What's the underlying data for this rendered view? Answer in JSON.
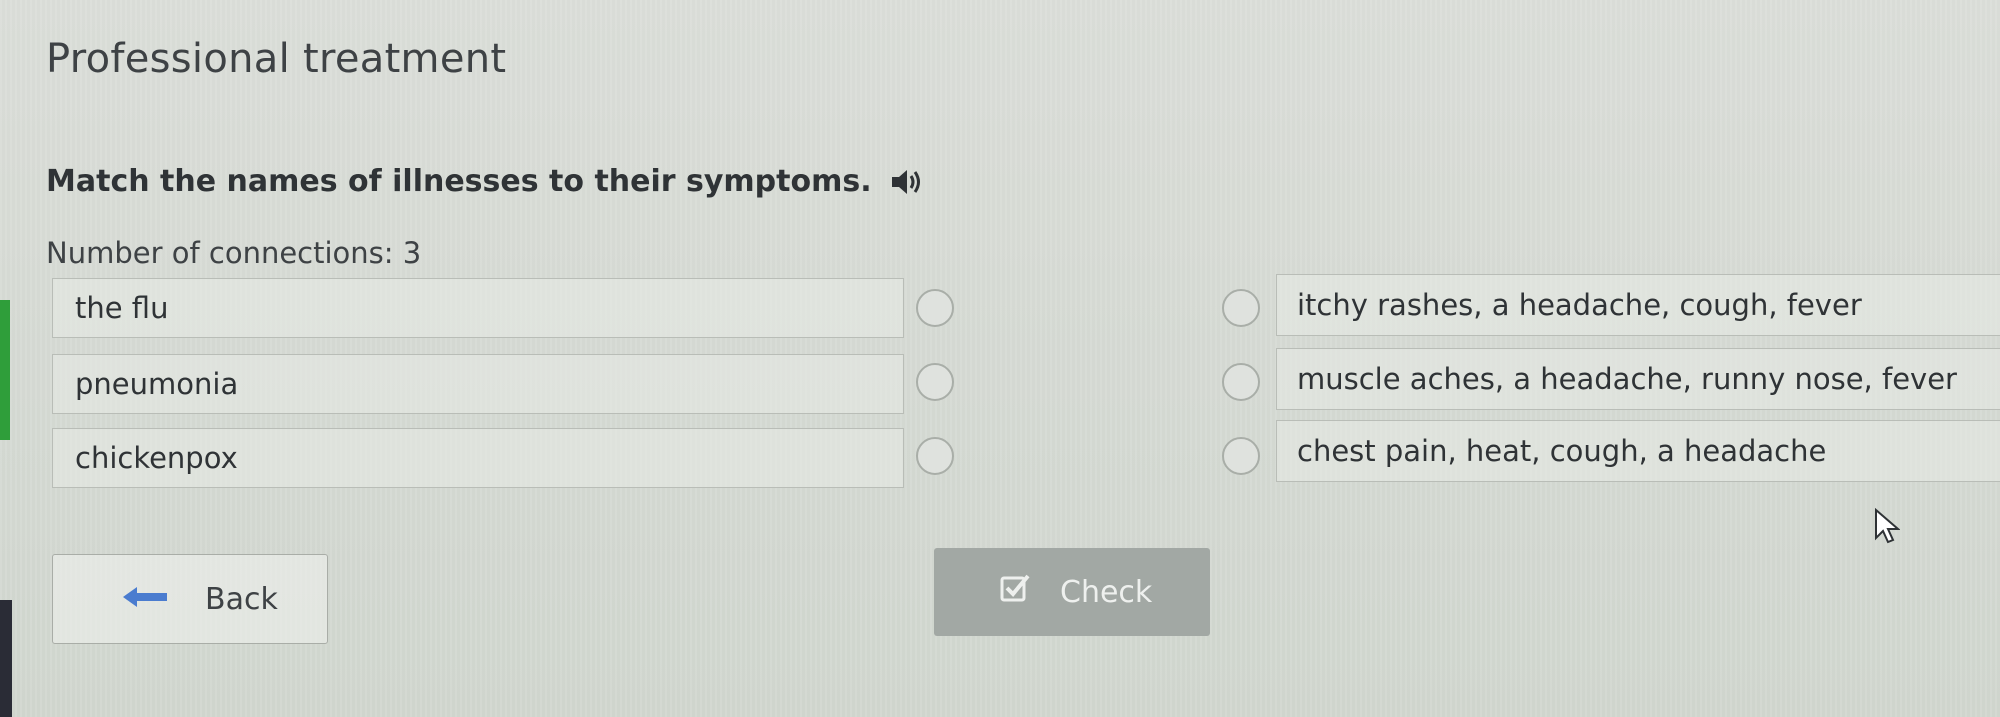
{
  "page": {
    "title": "Professional treatment",
    "instruction": "Match the names of illnesses to their symptoms.",
    "connections_label": "Number of connections: 3"
  },
  "left_items": [
    {
      "label": "the flu"
    },
    {
      "label": "pneumonia"
    },
    {
      "label": "chickenpox"
    }
  ],
  "right_items": [
    {
      "label": "itchy rashes, a headache, cough, fever"
    },
    {
      "label": "muscle aches, a headache, runny nose, fever"
    },
    {
      "label": "chest pain, heat, cough, a headache"
    }
  ],
  "buttons": {
    "back_label": "Back",
    "check_label": "Check"
  },
  "icons": {
    "speaker": "speaker-icon",
    "back": "arrow-left-icon",
    "check": "checkbox-icon",
    "cursor": "mouse-cursor-icon"
  },
  "colors": {
    "accent": "#2f9e3a",
    "check_button_bg": "#a2a8a4"
  }
}
